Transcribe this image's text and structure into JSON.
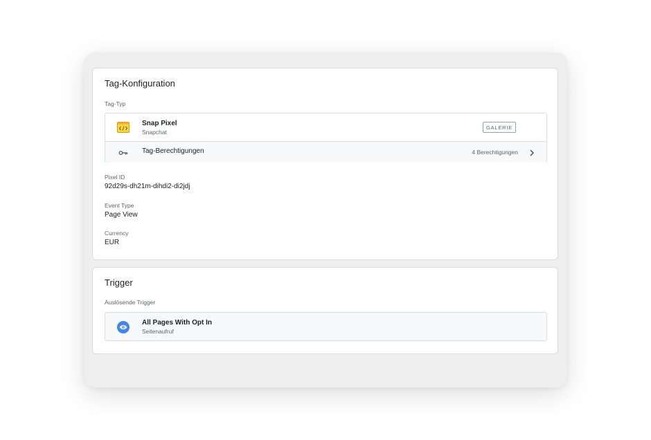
{
  "config_card": {
    "title": "Tag-Konfiguration",
    "tag_type_label": "Tag-Typ",
    "tag": {
      "name": "Snap Pixel",
      "vendor": "Snapchat",
      "icon": "code-icon",
      "gallery_button": "GALERIE"
    },
    "permissions": {
      "label": "Tag-Berechtigungen",
      "count": "4 Berechtigungen",
      "icon": "key-icon"
    },
    "fields": [
      {
        "label": "Pixel ID",
        "value": "92d29s-dh21m-dihdi2-di2jdj"
      },
      {
        "label": "Event Type",
        "value": "Page View"
      },
      {
        "label": "Currency",
        "value": "EUR"
      }
    ]
  },
  "trigger_card": {
    "title": "Trigger",
    "firing_label": "Auslösende Trigger",
    "trigger": {
      "name": "All Pages With Opt In",
      "type": "Seitenaufruf",
      "icon": "eye-icon"
    }
  },
  "colors": {
    "tag_icon_yellow": "#fdd835",
    "trigger_icon_blue": "#4285f4"
  }
}
